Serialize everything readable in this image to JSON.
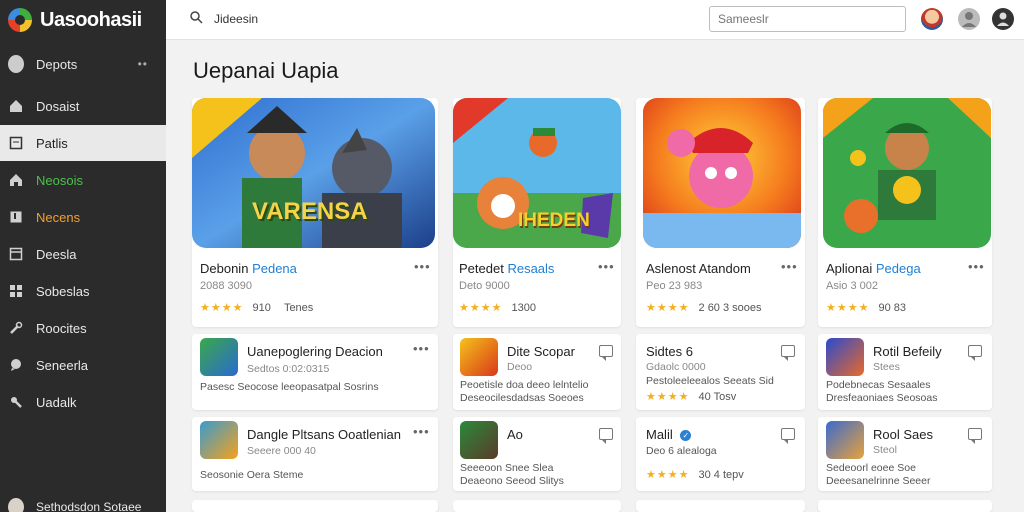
{
  "brand": {
    "name": "Uasoohasii"
  },
  "sidebar": {
    "items": [
      {
        "label": "Depots",
        "icon": "user-avatar-icon"
      },
      {
        "label": "Dosaist",
        "icon": "home-icon"
      },
      {
        "label": "Patlis",
        "icon": "square-icon"
      },
      {
        "label": "Neosois",
        "icon": "house-icon"
      },
      {
        "label": "Necens",
        "icon": "bookmark-icon"
      },
      {
        "label": "Deesla",
        "icon": "window-icon"
      },
      {
        "label": "Sobeslas",
        "icon": "grid-icon"
      },
      {
        "label": "Roocites",
        "icon": "wrench-icon"
      },
      {
        "label": "Seneerla",
        "icon": "chat-icon"
      },
      {
        "label": "Uadalk",
        "icon": "settings-icon"
      }
    ],
    "footer_label": "Sethodsdon Sotaee"
  },
  "topbar": {
    "search_text": "Jideesin",
    "input_placeholder": "Sameeslr"
  },
  "page": {
    "title": "Uepanai Uapia"
  },
  "featured": [
    {
      "title": "Debonin",
      "title_accent": "Pedena",
      "sub": "2088 3090",
      "rating_text": "910",
      "rating_extra": "Tenes",
      "banner": "VARENSA"
    },
    {
      "title": "Petedet",
      "title_accent": "Resaals",
      "sub": "Deto 9000",
      "rating_text": "1300",
      "rating_extra": "",
      "banner": "IHEDEN"
    },
    {
      "title": "Aslenost Atandom",
      "title_accent": "",
      "sub": "Peo 23 983",
      "rating_text": "2 60 3 sooes",
      "rating_extra": "",
      "banner": ""
    },
    {
      "title": "Aplionai",
      "title_accent": "Pedega",
      "sub": "Asio 3 002",
      "rating_text": "90 83",
      "rating_extra": "",
      "banner": ""
    }
  ],
  "lists": [
    {
      "title": "Uanepoglering Deacion",
      "line1": "Sedtos 0:02:0315",
      "line2": "Pasesc Seocose leeopasatpal Sosrins",
      "line3": ""
    },
    {
      "title": "Dite Scopar",
      "line1": "Deoo",
      "line2": "Peoetisle doa deeo lelntelio",
      "line3": "Deseocilesdadsas Soeoes"
    },
    {
      "title": "Sidtes 6",
      "line1": "Gdaolc 0000",
      "line2": "Pestoleeleealos Seeats Sid",
      "line3": "40 Tosv"
    },
    {
      "title": "Rotil Befeily",
      "line1": "Stees",
      "line2": "Podebnecas Sesaales",
      "line3": "Dresfeaoniaes Seosoas"
    },
    {
      "title": "Dangle Pltsans Ooatlenian",
      "line1": "Seeere 000 40",
      "line2": "Seosonie Oera Steme",
      "line3": ""
    },
    {
      "title": "Ao",
      "line1": "Seeeoon Snee Slea",
      "line2": "Deaeono Seeod Slitys",
      "line3": ""
    },
    {
      "title": "Malil",
      "line1": "Deo 6 alealoga",
      "line2": "30 4 tepv",
      "line3": ""
    },
    {
      "title": "Rool Saes",
      "line1": "Steol",
      "line2": "Sedeoorl eoee Soe",
      "line3": "Deeesanelrinne Seeer"
    }
  ],
  "colors": {
    "sidebar": "#2b2b2b",
    "accent": "#1e7fd6",
    "star": "#f2b01e"
  }
}
